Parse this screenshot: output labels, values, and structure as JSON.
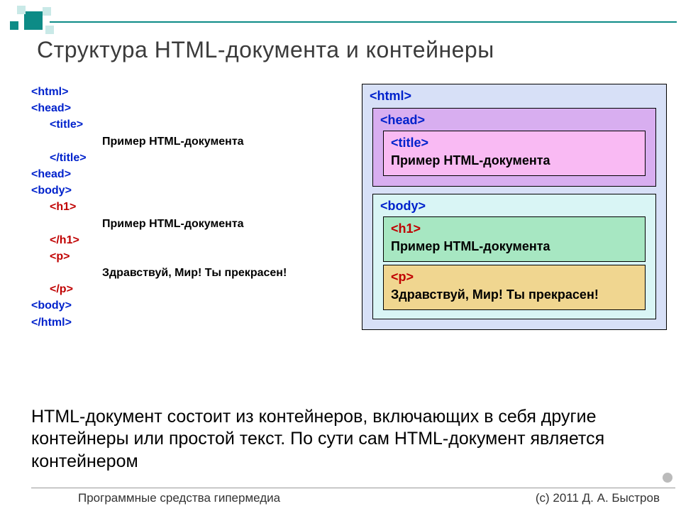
{
  "title": "Структура HTML-документа и контейнеры",
  "code": {
    "html_open": "<html>",
    "head_open": "<head>",
    "title_open": "<title>",
    "title_text": "Пример HTML-документа",
    "title_close": "</title>",
    "head_close": "<head>",
    "body_open": "<body>",
    "h1_open": "<h1>",
    "h1_text": "Пример HTML-документа",
    "h1_close": "</h1>",
    "p_open": "<p>",
    "p_text": "Здравствуй, Мир! Ты прекрасен!",
    "p_close": "</p>",
    "body_close": "<body>",
    "html_close": "</html>"
  },
  "diagram": {
    "html_label": "<html>",
    "head_label": "<head>",
    "title_label": "<title>",
    "title_text": "Пример HTML-документа",
    "body_label": "<body>",
    "h1_label": "<h1>",
    "h1_text": "Пример HTML-документа",
    "p_label": "<p>",
    "p_text": "Здравствуй, Мир! Ты прекрасен!"
  },
  "description": "HTML-документ состоит из контейнеров, включающих в себя другие контейнеры или простой текст. По сути сам HTML-документ является контейнером",
  "footer": {
    "left": "Программные средства гипермедиа",
    "right": "(c) 2011    Д. А. Быстров"
  }
}
